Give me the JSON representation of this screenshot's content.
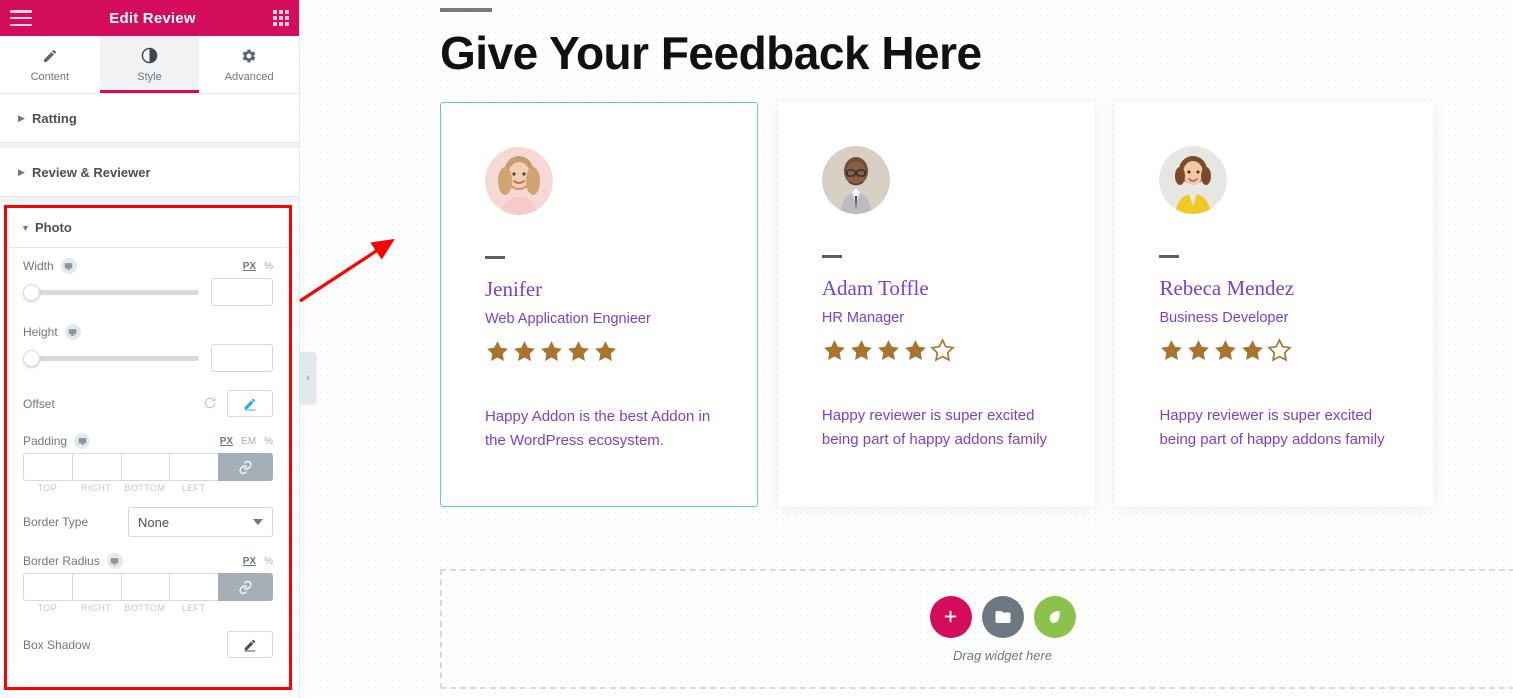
{
  "panel": {
    "header": {
      "title": "Edit Review",
      "menu_icon": "hamburger-icon",
      "apps_icon": "grid-apps-icon"
    },
    "tabs": [
      {
        "label": "Content",
        "icon": "pencil-icon",
        "active": false
      },
      {
        "label": "Style",
        "icon": "contrast-circle-icon",
        "active": true
      },
      {
        "label": "Advanced",
        "icon": "gear-icon",
        "active": false
      }
    ],
    "sections": [
      {
        "label": "Ratting",
        "expanded": false
      },
      {
        "label": "Review & Reviewer",
        "expanded": false
      },
      {
        "label": "Photo",
        "expanded": true
      }
    ],
    "photo_controls": {
      "width": {
        "label": "Width",
        "units": [
          "PX",
          "%"
        ],
        "active_unit": "PX",
        "value": "",
        "slider_position": 0
      },
      "height": {
        "label": "Height",
        "units": [
          "PX",
          "%"
        ],
        "active_unit": "PX",
        "value": "",
        "slider_position": 0
      },
      "offset": {
        "label": "Offset",
        "reset_icon": "reset-icon",
        "edit_icon": "pencil-edit-icon"
      },
      "padding": {
        "label": "Padding",
        "units": [
          "PX",
          "EM",
          "%"
        ],
        "active_unit": "PX",
        "values": [
          "",
          "",
          "",
          ""
        ],
        "side_labels": [
          "TOP",
          "RIGHT",
          "BOTTOM",
          "LEFT"
        ],
        "link_icon": "link-chain-icon",
        "linked": true
      },
      "border_type": {
        "label": "Border Type",
        "value": "None"
      },
      "border_radius": {
        "label": "Border Radius",
        "units": [
          "PX",
          "%"
        ],
        "active_unit": "PX",
        "values": [
          "",
          "",
          "",
          ""
        ],
        "side_labels": [
          "TOP",
          "RIGHT",
          "BOTTOM",
          "LEFT"
        ],
        "link_icon": "link-chain-icon",
        "linked": true
      },
      "box_shadow": {
        "label": "Box Shadow",
        "edit_icon": "pencil-edit-icon"
      }
    },
    "collapse_handle": "‹"
  },
  "canvas": {
    "heading": "Give Your Feedback Here",
    "cards": [
      {
        "name": "Jenifer",
        "role": "Web Application Engnieer",
        "rating": 5,
        "max_rating": 5,
        "text": "Happy Addon is the best Addon in the WordPress ecosystem.",
        "selected": true
      },
      {
        "name": "Adam Toffle",
        "role": "HR Manager",
        "rating": 4,
        "max_rating": 5,
        "text": "Happy reviewer is super excited being part of happy addons family",
        "selected": false
      },
      {
        "name": "Rebeca Mendez",
        "role": "Business Developer",
        "rating": 4,
        "max_rating": 5,
        "text": "Happy reviewer is super excited being part of happy addons family",
        "selected": false
      }
    ],
    "dropzone": {
      "label": "Drag widget here",
      "buttons": [
        {
          "icon": "plus-icon",
          "color": "#d30c5c"
        },
        {
          "icon": "folder-icon",
          "color": "#6d7882"
        },
        {
          "icon": "leaf-icon",
          "color": "#8bc34a"
        }
      ]
    }
  },
  "colors": {
    "brand_pink": "#d30c5c",
    "star_gold": "#a9742e",
    "review_purple": "#7b3fd4",
    "selection_blue": "#5ec8ec",
    "annotation_red": "#ff0000"
  }
}
